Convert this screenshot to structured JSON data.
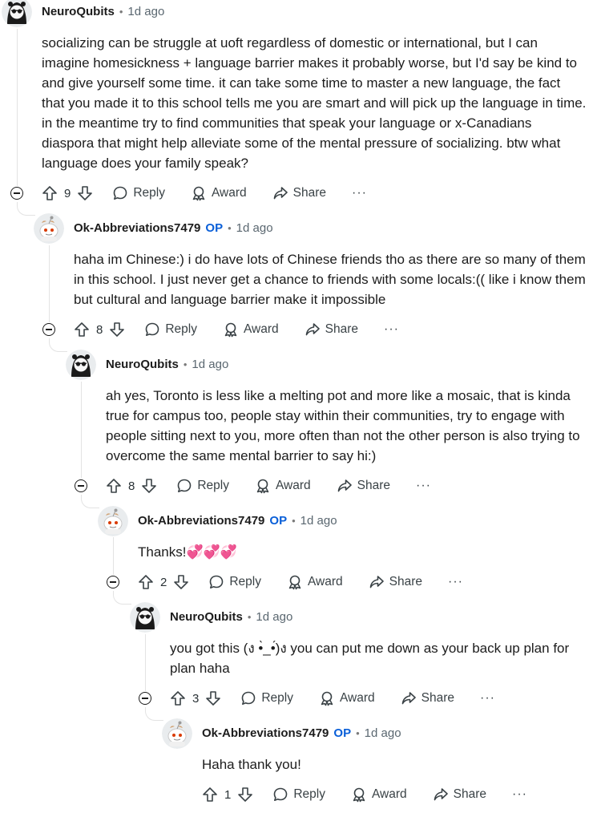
{
  "comments": [
    {
      "author": "NeuroQubits",
      "op_badge": "",
      "time": "1d ago",
      "text": "socializing can be struggle at uoft regardless of domestic or international, but I can imagine homesickness + language barrier makes it probably worse, but I'd say be kind to and give yourself some time. it can take some time to master a new language, the fact that you made it to this school tells me you are smart and will pick up the language in time. in the meantime try to find communities that speak your language or x-Canadians diaspora that might help alleviate some of the mental pressure of socializing. btw what language does your family speak?",
      "votes": "9",
      "reply": "Reply",
      "award": "Award",
      "share": "Share",
      "more": "···"
    },
    {
      "author": "Ok-Abbreviations7479",
      "op_badge": "OP",
      "time": "1d ago",
      "text": "haha im Chinese:) i do have lots of Chinese friends tho as there are so many of them in this school. I just never get a chance to friends with some locals:(( like i know them but cultural and language barrier make it impossible",
      "votes": "8",
      "reply": "Reply",
      "award": "Award",
      "share": "Share",
      "more": "···"
    },
    {
      "author": "NeuroQubits",
      "op_badge": "",
      "time": "1d ago",
      "text": "ah yes, Toronto is less like a melting pot and more like a mosaic, that is kinda true for campus too, people stay within their communities, try to engage with people sitting next to you, more often than not the other person is also trying to overcome the same mental barrier to say hi:)",
      "votes": "8",
      "reply": "Reply",
      "award": "Award",
      "share": "Share",
      "more": "···"
    },
    {
      "author": "Ok-Abbreviations7479",
      "op_badge": "OP",
      "time": "1d ago",
      "text": "Thanks!💞💞💞",
      "votes": "2",
      "reply": "Reply",
      "award": "Award",
      "share": "Share",
      "more": "···"
    },
    {
      "author": "NeuroQubits",
      "op_badge": "",
      "time": "1d ago",
      "text": "you got this (ง •̀_•́)ง you can put me down as your back up plan for plan haha",
      "votes": "3",
      "reply": "Reply",
      "award": "Award",
      "share": "Share",
      "more": "···"
    },
    {
      "author": "Ok-Abbreviations7479",
      "op_badge": "OP",
      "time": "1d ago",
      "text": "Haha thank you!",
      "votes": "1",
      "reply": "Reply",
      "award": "Award",
      "share": "Share",
      "more": "···"
    }
  ],
  "icons": {
    "upvote": "arrow-up-icon",
    "downvote": "arrow-down-icon",
    "reply": "speech-bubble-icon",
    "award": "award-ribbon-icon",
    "share": "share-arrow-icon",
    "collapse": "collapse-minus-icon"
  },
  "colors": {
    "op_badge": "#0a5fd8",
    "thread_line": "#e3e3e3",
    "meta_text": "#5a6770"
  }
}
